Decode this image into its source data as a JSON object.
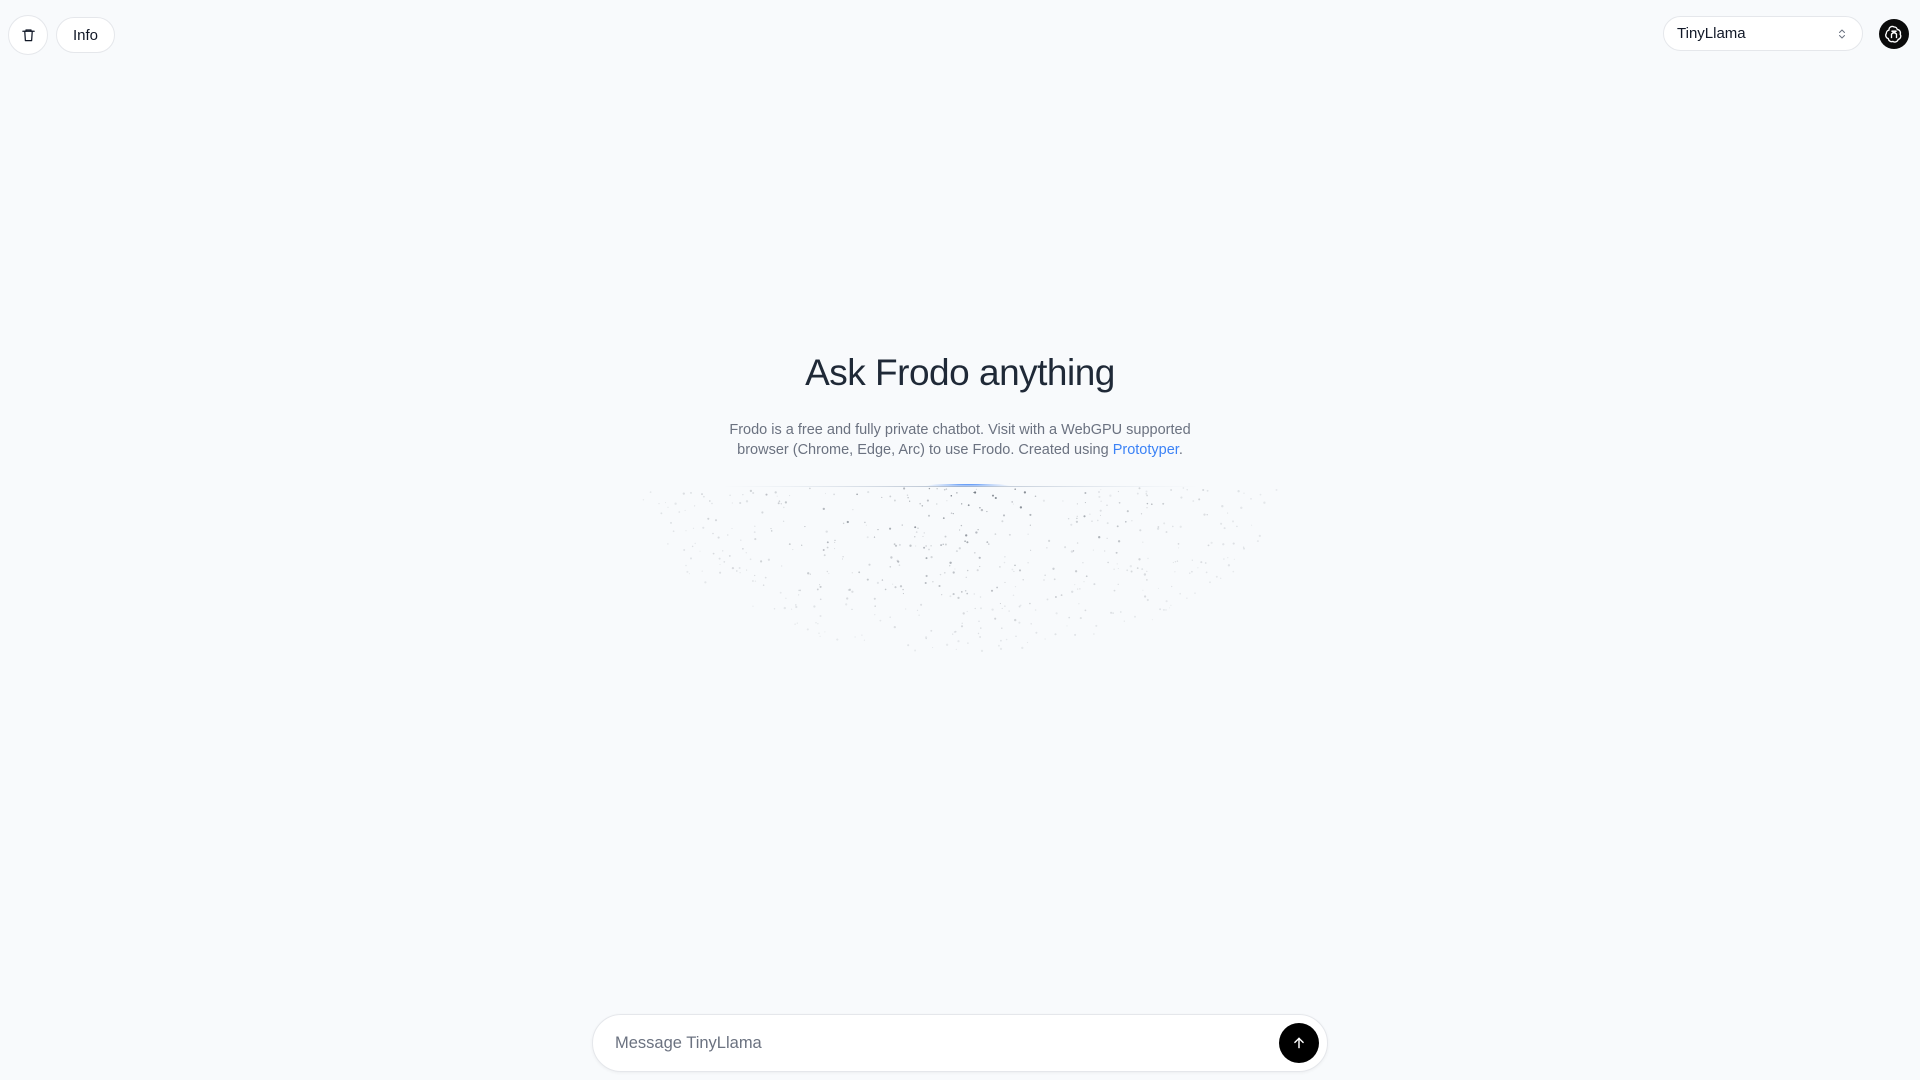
{
  "toolbar": {
    "clear_icon": "trash-icon",
    "info_label": "Info"
  },
  "model_selector": {
    "selected": "TinyLlama",
    "icon": "chevron-up-down-icon"
  },
  "avatar": {
    "icon": "openai-logo-icon"
  },
  "hero": {
    "title": "Ask Frodo anything",
    "description_prefix": "Frodo is a free and fully private chatbot. Visit with a WebGPU supported browser (Chrome, Edge, Arc) to use Frodo. Created using ",
    "link_text": "Prototyper",
    "description_suffix": "."
  },
  "composer": {
    "placeholder": "Message TinyLlama",
    "send_icon": "arrow-up-icon"
  },
  "colors": {
    "background": "#f8fafc",
    "accent_link": "#3b82f6",
    "send_button": "#000000"
  }
}
